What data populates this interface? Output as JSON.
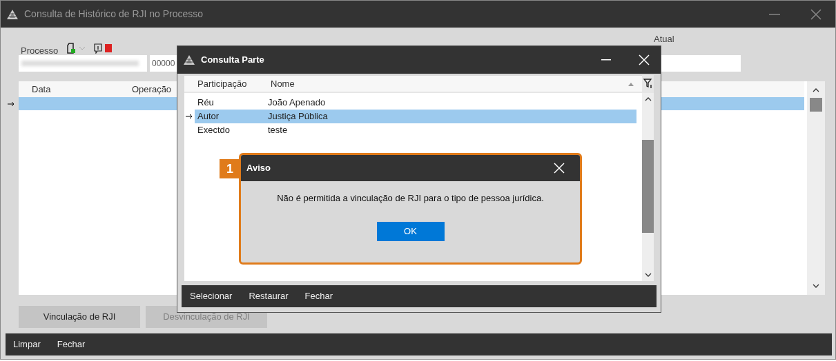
{
  "main_window": {
    "title": "Consulta de Histórico de RJI no Processo",
    "processo": {
      "label": "Processo",
      "field_1": {
        "redacted": true
      },
      "field_2": {
        "value": "00000"
      }
    },
    "rji_atual": {
      "label": "Atual"
    },
    "table": {
      "columns": [
        "Data",
        "Operação"
      ],
      "rows": [
        {
          "selected": true
        }
      ]
    },
    "buttons": [
      {
        "label": "Vinculação de RJI",
        "disabled": false
      },
      {
        "label": "Desvinculação de RJI",
        "disabled": true
      }
    ],
    "footer": [
      "Limpar",
      "Fechar"
    ]
  },
  "dialog": {
    "title": "Consulta Parte",
    "columns": [
      "Participação",
      "Nome"
    ],
    "rows": [
      {
        "participacao": "Réu",
        "nome": "João Apenado",
        "selected": false
      },
      {
        "participacao": "Autor",
        "nome": "Justiça Pública",
        "selected": true
      },
      {
        "participacao": "Exectdo",
        "nome": "teste",
        "selected": false
      }
    ],
    "footer": [
      "Selecionar",
      "Restaurar",
      "Fechar"
    ]
  },
  "alert": {
    "badge": "1",
    "title": "Aviso",
    "message": "Não é permitida a vinculação de RJI para o tipo de pessoa jurídica.",
    "button": "OK"
  }
}
